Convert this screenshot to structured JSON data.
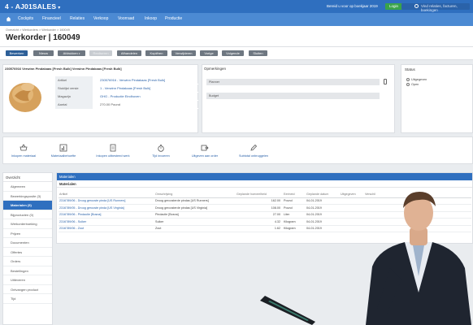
{
  "topbar": {
    "title": "4 - AJ01SALES",
    "promo": "Bereid u voor op boekjaar 2019",
    "login": "Login",
    "search_placeholder": "Vind relaties, facturen, boekingen"
  },
  "menu": [
    "Cockpits",
    "Financieel",
    "Relaties",
    "Verkoop",
    "Voorraad",
    "Inkoop",
    "Productie"
  ],
  "breadcrumb": "Overzicht > Werkorders > Werkorder > 160049",
  "page_title": "Werkorder | 160049",
  "actions": [
    {
      "label": "Bewerken",
      "style": "primary",
      "caret": false
    },
    {
      "label": "Nieuw",
      "style": "normal",
      "caret": false
    },
    {
      "label": "Afdrukken",
      "style": "normal",
      "caret": true
    },
    {
      "label": "Realiseren",
      "style": "disabled",
      "caret": false
    },
    {
      "label": "Afhandelen",
      "style": "normal",
      "caret": false
    },
    {
      "label": "Kopiëren",
      "style": "normal",
      "caret": false
    },
    {
      "label": "Verwijderen",
      "style": "normal",
      "caret": false
    },
    {
      "label": "Vorige",
      "style": "normal",
      "caret": false
    },
    {
      "label": "Volgende",
      "style": "normal",
      "caret": false
    },
    {
      "label": "Sluiten",
      "style": "normal",
      "caret": false
    }
  ],
  "product": {
    "title": "230576916 Verwinn Pindakaas [Fresh Bulk] Verwinn Pindakaas [Fresh Bulk]",
    "fields": [
      {
        "label": "Artikel",
        "value": "230576916 - Verwinn Pindakaas [Fresh Bulk]",
        "link": true
      },
      {
        "label": "Stuklijst versie",
        "value": "1 - Verwinn Pindakaas [Fresh Bulk]",
        "link": true
      },
      {
        "label": "Magazijn",
        "value": "GHG - Productie Eindhoven",
        "link": true
      },
      {
        "label": "Aantal",
        "value": "270.00 Pound",
        "link": false
      }
    ]
  },
  "notes": {
    "title": "Opmerkingen",
    "fields": [
      "Planner",
      "Budget"
    ]
  },
  "status": {
    "title": "Status",
    "options": [
      "Uitgegeven",
      "Open"
    ]
  },
  "quick_actions": [
    {
      "label": "Inkopen materiaal",
      "icon": "basket-icon"
    },
    {
      "label": "Materiaalbehoefte",
      "icon": "chart-icon"
    },
    {
      "label": "Inkopen uitbesteed werk",
      "icon": "document-icon"
    },
    {
      "label": "Tijd invoeren",
      "icon": "stopwatch-icon"
    },
    {
      "label": "Uitgeven aan order",
      "icon": "arrow-out-icon"
    },
    {
      "label": "Subtotal onbruggeien",
      "icon": "edit-icon"
    }
  ],
  "sidebar": {
    "header": "Overzicht",
    "items": [
      {
        "label": "Algemeen",
        "active": false
      },
      {
        "label": "Bewerkingsposite (3)",
        "active": false
      },
      {
        "label": "Materialen (5)",
        "active": true
      },
      {
        "label": "Bijproducten (0)",
        "active": false
      },
      {
        "label": "Werkorderboeking",
        "active": false
      },
      {
        "label": "Prijzen",
        "active": false
      },
      {
        "label": "Documenten",
        "active": false
      },
      {
        "label": "Offertes",
        "active": false
      },
      {
        "label": "Orders",
        "active": false
      },
      {
        "label": "Bestellingen",
        "active": false
      },
      {
        "label": "Uitleveren",
        "active": false
      },
      {
        "label": "Ontvangen product",
        "active": false
      },
      {
        "label": "Tijd",
        "active": false
      }
    ]
  },
  "materials": {
    "header": "Materialen",
    "subheader": "Materialen",
    "columns": [
      "Artikel",
      "Omschrijving",
      "Geplande hoeveelheid",
      "Eenheid",
      "Geplande datum",
      "Uitgegeven",
      "Verschil"
    ],
    "rows": [
      [
        "2316789/06 - Droog gerooste pinda [US Runners]",
        "Droog geroosterde pindas [US Runners]",
        "162.00",
        "Pound",
        "04-01-2019",
        "",
        ""
      ],
      [
        "2316789/05 - Droog gerooste pinda [US Virginia]",
        "Droog geroosterde pindas [US Virginia]",
        "108.00",
        "Pound",
        "04-01-2019",
        "",
        ""
      ],
      [
        "2316789/06 - Pindaolie [Bosna]",
        "Pindaolie [Bosna]",
        "27.00",
        "Liter",
        "04-01-2019",
        "",
        ""
      ],
      [
        "2316789/06 - Suiker",
        "Suiker",
        "4.32",
        "Kilogram",
        "04-01-2019",
        "",
        ""
      ],
      [
        "2316789/06 - Zout",
        "Zout",
        "1.62",
        "Kilogram",
        "04-01-2019",
        "",
        ""
      ]
    ]
  },
  "colors": {
    "topbar": "#2f6fbf",
    "menubar": "#4c8ad3",
    "accent": "#2a62a9",
    "login": "#3aa34a"
  }
}
